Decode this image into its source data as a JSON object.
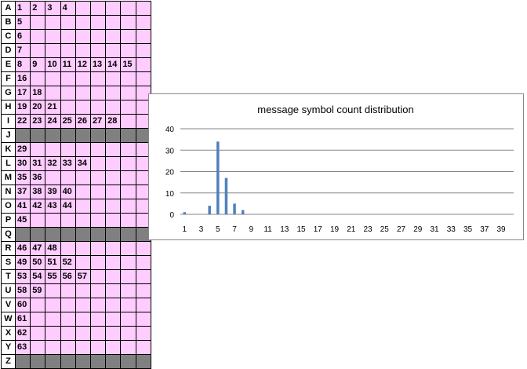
{
  "grid": {
    "rows": [
      {
        "label": "A",
        "shaded": false,
        "values": [
          "1",
          "2",
          "3",
          "4"
        ]
      },
      {
        "label": "B",
        "shaded": false,
        "values": [
          "5"
        ]
      },
      {
        "label": "C",
        "shaded": false,
        "values": [
          "6"
        ]
      },
      {
        "label": "D",
        "shaded": false,
        "values": [
          "7"
        ]
      },
      {
        "label": "E",
        "shaded": false,
        "values": [
          "8",
          "9",
          "10",
          "11",
          "12",
          "13",
          "14",
          "15"
        ]
      },
      {
        "label": "F",
        "shaded": false,
        "values": [
          "16"
        ]
      },
      {
        "label": "G",
        "shaded": false,
        "values": [
          "17",
          "18"
        ]
      },
      {
        "label": "H",
        "shaded": false,
        "values": [
          "19",
          "20",
          "21"
        ]
      },
      {
        "label": "I",
        "shaded": false,
        "values": [
          "22",
          "23",
          "24",
          "25",
          "26",
          "27",
          "28"
        ]
      },
      {
        "label": "J",
        "shaded": true,
        "values": []
      },
      {
        "label": "K",
        "shaded": false,
        "values": [
          "29"
        ]
      },
      {
        "label": "L",
        "shaded": false,
        "values": [
          "30",
          "31",
          "32",
          "33",
          "34"
        ]
      },
      {
        "label": "M",
        "shaded": false,
        "values": [
          "35",
          "36"
        ]
      },
      {
        "label": "N",
        "shaded": false,
        "values": [
          "37",
          "38",
          "39",
          "40"
        ]
      },
      {
        "label": "O",
        "shaded": false,
        "values": [
          "41",
          "42",
          "43",
          "44"
        ]
      },
      {
        "label": "P",
        "shaded": false,
        "values": [
          "45"
        ]
      },
      {
        "label": "Q",
        "shaded": true,
        "values": []
      },
      {
        "label": "R",
        "shaded": false,
        "values": [
          "46",
          "47",
          "48"
        ]
      },
      {
        "label": "S",
        "shaded": false,
        "values": [
          "49",
          "50",
          "51",
          "52"
        ]
      },
      {
        "label": "T",
        "shaded": false,
        "values": [
          "53",
          "54",
          "55",
          "56",
          "57"
        ]
      },
      {
        "label": "U",
        "shaded": false,
        "values": [
          "58",
          "59"
        ]
      },
      {
        "label": "V",
        "shaded": false,
        "values": [
          "60"
        ]
      },
      {
        "label": "W",
        "shaded": false,
        "values": [
          "61"
        ]
      },
      {
        "label": "X",
        "shaded": false,
        "values": [
          "62"
        ]
      },
      {
        "label": "Y",
        "shaded": false,
        "values": [
          "63"
        ]
      },
      {
        "label": "Z",
        "shaded": true,
        "values": []
      }
    ],
    "colors": {
      "fill": "#ffccff",
      "shaded": "#808080",
      "line": "#000000"
    }
  },
  "chart_data": {
    "type": "bar",
    "title": "message symbol count distribution",
    "xlabel": "",
    "ylabel": "",
    "categories": [
      "1",
      "2",
      "3",
      "4",
      "5",
      "6",
      "7",
      "8",
      "9",
      "10",
      "11",
      "12",
      "13",
      "14",
      "15",
      "16",
      "17",
      "18",
      "19",
      "20",
      "21",
      "22",
      "23",
      "24",
      "25",
      "26",
      "27",
      "28",
      "29",
      "30",
      "31",
      "32",
      "33",
      "34",
      "35",
      "36",
      "37",
      "38",
      "39",
      "40"
    ],
    "x_tick_labels": [
      "1",
      "3",
      "5",
      "7",
      "9",
      "11",
      "13",
      "15",
      "17",
      "19",
      "21",
      "23",
      "25",
      "27",
      "29",
      "31",
      "33",
      "35",
      "37",
      "39"
    ],
    "values": [
      1,
      0,
      0,
      4,
      34,
      17,
      5,
      2,
      0,
      0,
      0,
      0,
      0,
      0,
      0,
      0,
      0,
      0,
      0,
      0,
      0,
      0,
      0,
      0,
      0,
      0,
      0,
      0,
      0,
      0,
      0,
      0,
      0,
      0,
      0,
      0,
      0,
      0,
      0,
      0
    ],
    "ylim": [
      0,
      40
    ],
    "y_ticks": [
      "0",
      "10",
      "20",
      "30",
      "40"
    ],
    "grid": true,
    "legend": "none",
    "bar_color": "#4f81bd",
    "gridline_color": "#868686"
  }
}
